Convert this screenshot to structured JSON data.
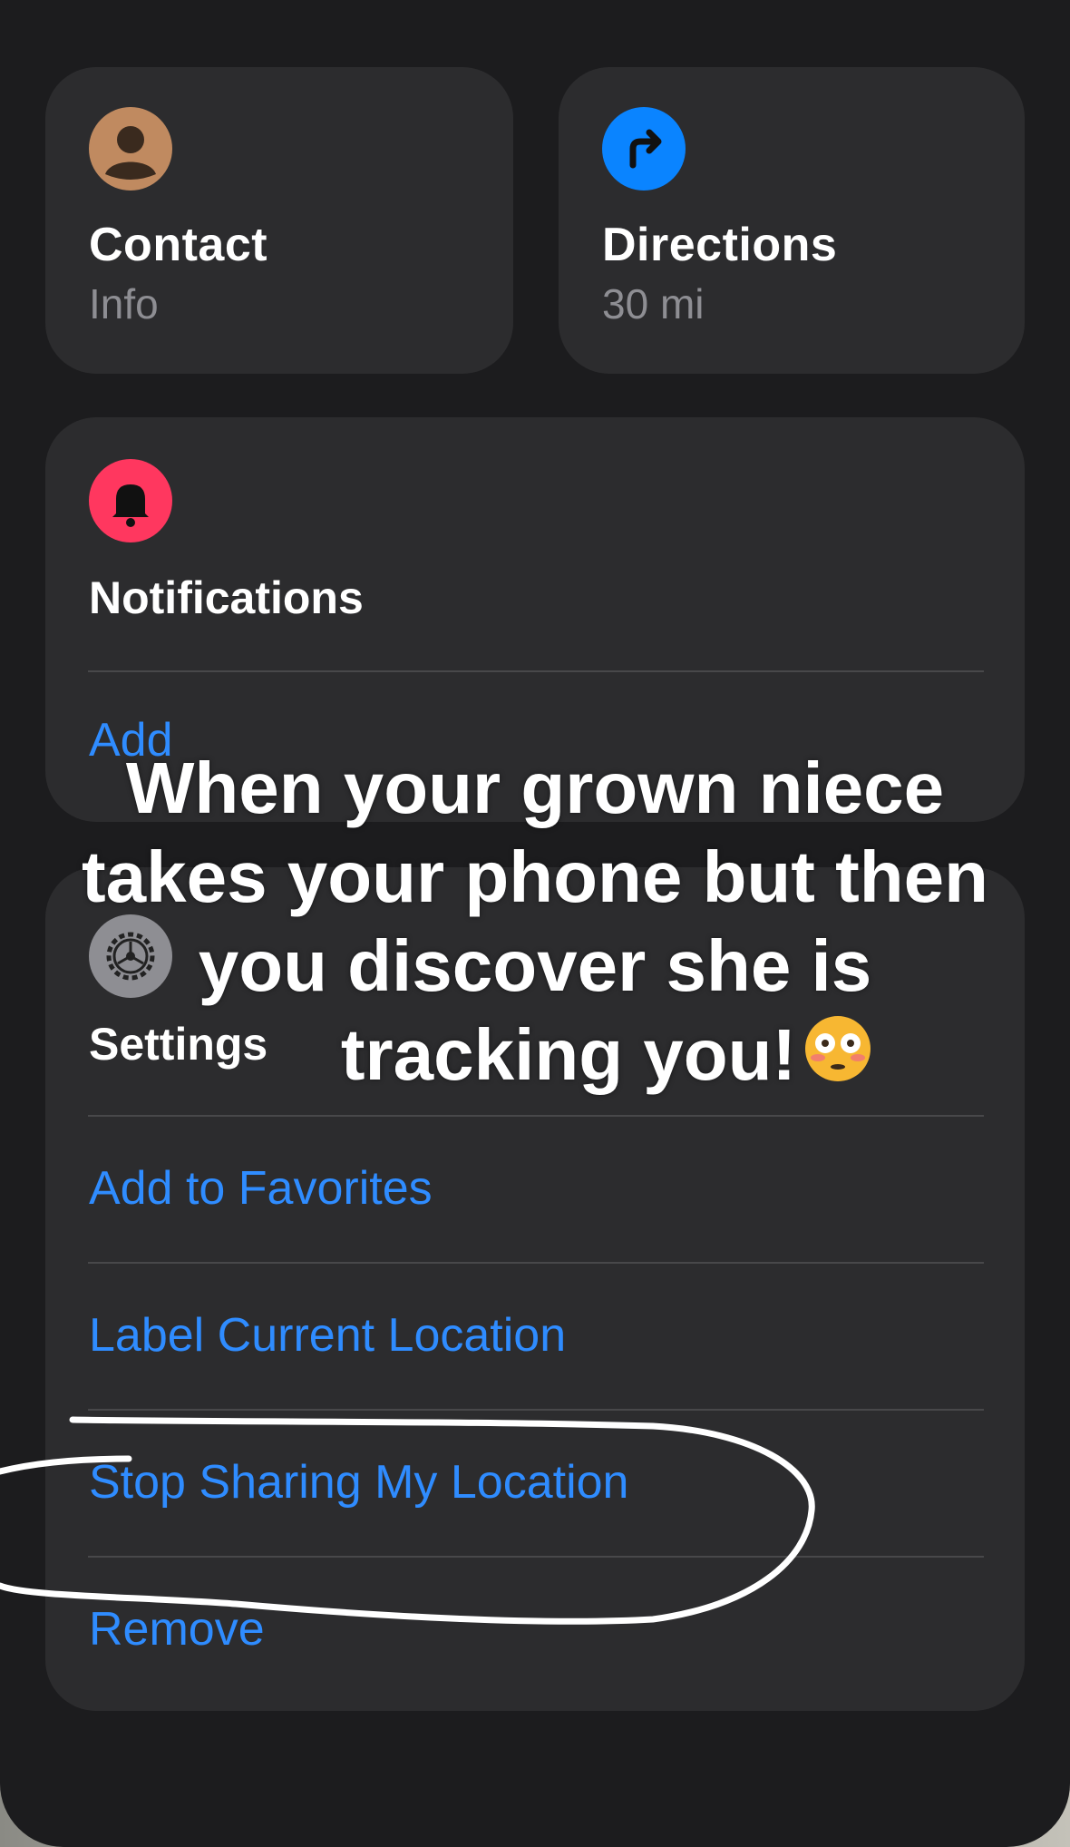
{
  "tiles": {
    "contact": {
      "title": "Contact",
      "subtitle": "Info",
      "icon": "person-icon",
      "color": "#c08a60"
    },
    "directions": {
      "title": "Directions",
      "subtitle": "30 mi",
      "icon": "turn-right-arrow-icon",
      "color": "#0a84ff"
    }
  },
  "notifications": {
    "title": "Notifications",
    "icon": "bell-icon",
    "color": "#ff375f",
    "action": "Add"
  },
  "settings": {
    "title": "Settings",
    "icon": "gear-icon",
    "color": "#8e8e93",
    "actions": [
      "Add to Favorites",
      "Label Current Location",
      "Stop Sharing My Location",
      "Remove"
    ]
  },
  "overlay": {
    "line1": "When your grown niece",
    "line2": "takes your phone but then",
    "line3": "you discover she is",
    "line4": "tracking you!",
    "emoji": "flushed-face-emoji"
  },
  "colors": {
    "background": "#1c1c1e",
    "card": "#2c2c2e",
    "link": "#2f8cff",
    "separator": "#48484a"
  }
}
